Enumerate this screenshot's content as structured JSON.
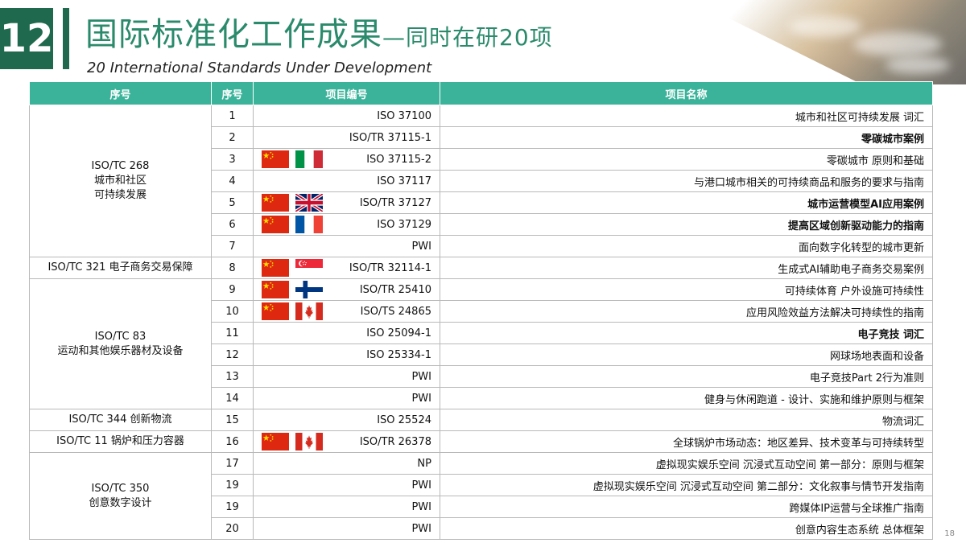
{
  "slide": {
    "number": "12",
    "page": "18"
  },
  "header": {
    "title_main": "国际标准化工作成果",
    "title_sub": "—同时在研20项",
    "subtitle": "20 International Standards Under Development"
  },
  "table": {
    "headers": [
      "序号",
      "序号",
      "项目编号",
      "项目名称"
    ],
    "groups": [
      {
        "tc": "ISO/TC 268\n城市和社区\n可持续发展",
        "rows": [
          {
            "num": "1",
            "code": "ISO 37100",
            "flags": [],
            "name": "城市和社区可持续发展 词汇",
            "bold": false
          },
          {
            "num": "2",
            "code": "ISO/TR 37115-1",
            "flags": [],
            "name": "零碳城市案例",
            "bold": true
          },
          {
            "num": "3",
            "code": "ISO 37115-2",
            "flags": [
              "cn",
              "it"
            ],
            "name": "零碳城市 原则和基础",
            "bold": false
          },
          {
            "num": "4",
            "code": "ISO 37117",
            "flags": [],
            "name": "与港口城市相关的可持续商品和服务的要求与指南",
            "bold": false
          },
          {
            "num": "5",
            "code": "ISO/TR 37127",
            "flags": [
              "cn",
              "gb"
            ],
            "name": "城市运营模型AI应用案例",
            "bold": true
          },
          {
            "num": "6",
            "code": "ISO 37129",
            "flags": [
              "cn",
              "fr"
            ],
            "name": "提高区域创新驱动能力的指南",
            "bold": true
          },
          {
            "num": "7",
            "code": "PWI",
            "flags": [],
            "name": "面向数字化转型的城市更新",
            "bold": false
          }
        ]
      },
      {
        "tc": "ISO/TC 321 电子商务交易保障",
        "rows": [
          {
            "num": "8",
            "code": "ISO/TR 32114-1",
            "flags": [
              "cn",
              "sg"
            ],
            "name": "生成式AI辅助电子商务交易案例",
            "bold": false
          }
        ]
      },
      {
        "tc": "ISO/TC 83\n运动和其他娱乐器材及设备",
        "rows": [
          {
            "num": "9",
            "code": "ISO/TR 25410",
            "flags": [
              "cn",
              "fi"
            ],
            "name": "可持续体育 户外设施可持续性",
            "bold": false
          },
          {
            "num": "10",
            "code": "ISO/TS 24865",
            "flags": [
              "cn",
              "ca"
            ],
            "name": "应用风险效益方法解决可持续性的指南",
            "bold": false
          },
          {
            "num": "11",
            "code": "ISO 25094-1",
            "flags": [],
            "name": "电子竞技 词汇",
            "bold": true
          },
          {
            "num": "12",
            "code": "ISO 25334-1",
            "flags": [],
            "name": "网球场地表面和设备",
            "bold": false
          },
          {
            "num": "13",
            "code": "PWI",
            "flags": [],
            "name": "电子竞技Part 2行为准则",
            "bold": false
          },
          {
            "num": "14",
            "code": "PWI",
            "flags": [],
            "name": "健身与休闲跑道 - 设计、实施和维护原则与框架",
            "bold": false
          }
        ]
      },
      {
        "tc": "ISO/TC 344 创新物流",
        "rows": [
          {
            "num": "15",
            "code": "ISO 25524",
            "flags": [],
            "name": "物流词汇",
            "bold": false
          }
        ]
      },
      {
        "tc": "ISO/TC 11 锅炉和压力容器",
        "rows": [
          {
            "num": "16",
            "code": "ISO/TR 26378",
            "flags": [
              "cn",
              "ca"
            ],
            "name": "全球锅炉市场动态：地区差异、技术变革与可持续转型",
            "bold": false
          }
        ]
      },
      {
        "tc": "ISO/TC 350\n创意数字设计",
        "rows": [
          {
            "num": "17",
            "code": "NP",
            "flags": [],
            "name": "虚拟现实娱乐空间 沉浸式互动空间 第一部分：原则与框架",
            "bold": false
          },
          {
            "num": "19",
            "code": "PWI",
            "flags": [],
            "name": "虚拟现实娱乐空间 沉浸式互动空间 第二部分：文化叙事与情节开发指南",
            "bold": false
          },
          {
            "num": "19",
            "code": "PWI",
            "flags": [],
            "name": "跨媒体IP运营与全球推广指南",
            "bold": false
          },
          {
            "num": "20",
            "code": "PWI",
            "flags": [],
            "name": "创意内容生态系统 总体框架",
            "bold": false
          }
        ]
      }
    ]
  }
}
